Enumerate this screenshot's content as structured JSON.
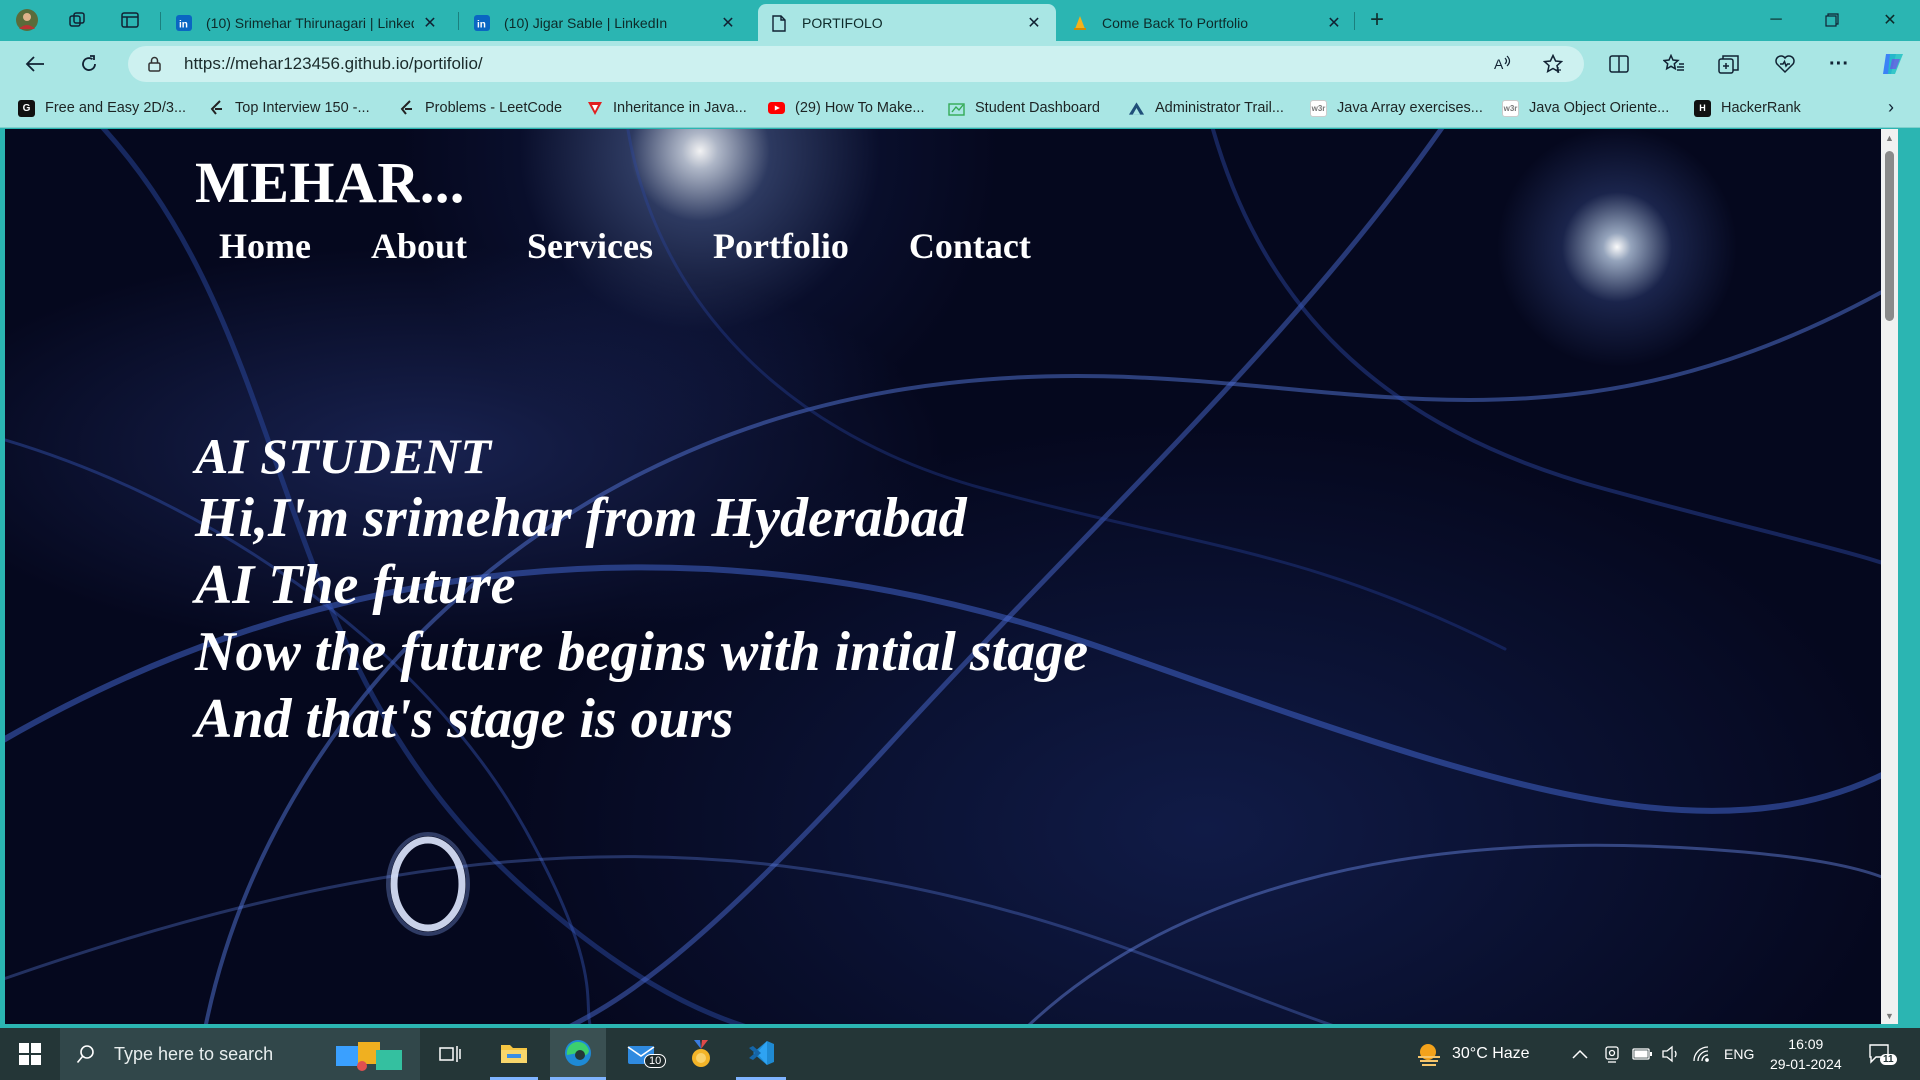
{
  "browser": {
    "tabs": [
      {
        "title": "(10) Srimehar Thirunagari | LinkedIn",
        "icon": "linkedin-icon",
        "active": false
      },
      {
        "title": "(10) Jigar Sable | LinkedIn",
        "icon": "linkedin-icon",
        "active": false
      },
      {
        "title": "PORTIFOLO",
        "icon": "page-icon",
        "active": true
      },
      {
        "title": "Come Back To Portfolio",
        "icon": "cone-icon",
        "active": false
      }
    ],
    "address_url": "https://mehar123456.github.io/portifolio/",
    "bookmarks": [
      {
        "label": "Free and Easy 2D/3...",
        "icon": "g-icon"
      },
      {
        "label": "Top Interview 150 -...",
        "icon": "leetcode-icon"
      },
      {
        "label": "Problems - LeetCode",
        "icon": "leetcode-icon"
      },
      {
        "label": "Inheritance in Java...",
        "icon": "javatpoint-icon"
      },
      {
        "label": "(29) How To Make...",
        "icon": "youtube-icon"
      },
      {
        "label": "Student Dashboard",
        "icon": "dashboard-icon"
      },
      {
        "label": "Administrator Trail...",
        "icon": "trailhead-icon"
      },
      {
        "label": "Java Array exercises...",
        "icon": "w3r-icon"
      },
      {
        "label": "Java Object Oriente...",
        "icon": "w3r-icon"
      },
      {
        "label": "HackerRank",
        "icon": "hackerrank-icon"
      }
    ]
  },
  "page": {
    "logo": "MEHAR...",
    "nav": [
      "Home",
      "About",
      "Services",
      "Portfolio",
      "Contact"
    ],
    "hero": [
      "AI STUDENT",
      "Hi,I'm srimehar from Hyderabad",
      "AI The future",
      "Now the future begins with intial stage",
      "And that's stage is ours"
    ]
  },
  "taskbar": {
    "search_placeholder": "Type here to search",
    "mail_badge": "10",
    "weather": "30°C  Haze",
    "language": "ENG",
    "time": "16:09",
    "date": "29-01-2024",
    "notification_count": "11"
  },
  "colors": {
    "browser_frame": "#2bb5b2",
    "toolbar": "#a9e6e4",
    "taskbar": "#243637",
    "page_background": "#05081e"
  }
}
